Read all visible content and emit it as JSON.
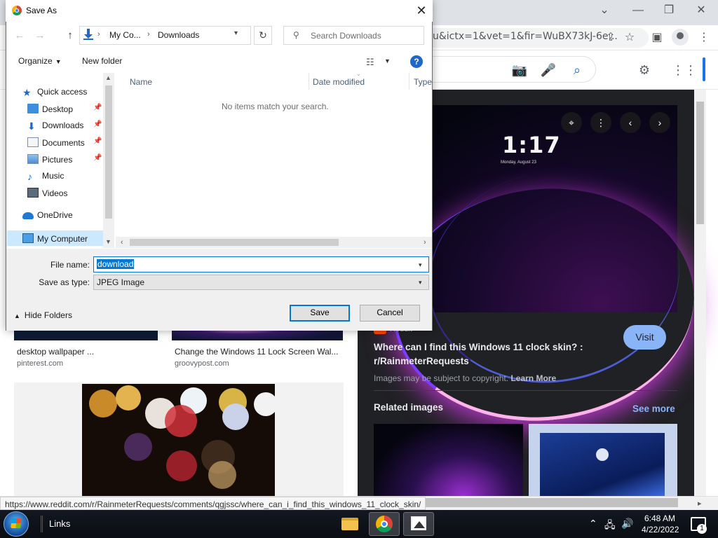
{
  "browser": {
    "url": "u&ictx=1&vet=1&fir=WuBX73kJ-6e...",
    "window_controls": {
      "min": "—",
      "restore": "❐",
      "close": "✕",
      "chevron": "⌄"
    }
  },
  "results": {
    "items": [
      {
        "title": "desktop wallpaper ...",
        "source": "pinterest.com"
      },
      {
        "title": "Change the Windows 11 Lock Screen Wal...",
        "source": "groovypost.com"
      }
    ]
  },
  "panel": {
    "preview_time": "1:17",
    "preview_date": "Monday, August 23",
    "source": "Reddit",
    "visit_label": "Visit",
    "title": "Where can I find this Windows 11 clock skin? : r/RainmeterRequests",
    "copyright_text": "Images may be subject to copyright.",
    "learn_more": "Learn More",
    "related_label": "Related images",
    "see_more": "See more"
  },
  "status_url": "https://www.reddit.com/r/RainmeterRequests/comments/qgjssc/where_can_i_find_this_windows_11_clock_skin/",
  "taskbar": {
    "links_label": "Links",
    "time": "6:48 AM",
    "date": "4/22/2022",
    "notification_count": "1"
  },
  "dialog": {
    "title": "Save As",
    "address": {
      "crumb1": "My Co...",
      "crumb2": "Downloads"
    },
    "search_placeholder": "Search Downloads",
    "organize_label": "Organize",
    "new_folder_label": "New folder",
    "nav_items": [
      {
        "label": "Quick access"
      },
      {
        "label": "Desktop"
      },
      {
        "label": "Downloads"
      },
      {
        "label": "Documents"
      },
      {
        "label": "Pictures"
      },
      {
        "label": "Music"
      },
      {
        "label": "Videos"
      },
      {
        "label": "OneDrive"
      },
      {
        "label": "My Computer"
      }
    ],
    "columns": {
      "name": "Name",
      "date_modified": "Date modified",
      "type": "Type"
    },
    "empty_message": "No items match your search.",
    "file_name_label": "File name:",
    "file_name_value": "download",
    "save_type_label": "Save as type:",
    "save_type_value": "JPEG Image",
    "hide_folders_label": "Hide Folders",
    "save_label": "Save",
    "cancel_label": "Cancel"
  },
  "colors": {
    "accent": "#0078d7",
    "panel_bg": "#202124",
    "link_blue": "#8ab4f8"
  }
}
